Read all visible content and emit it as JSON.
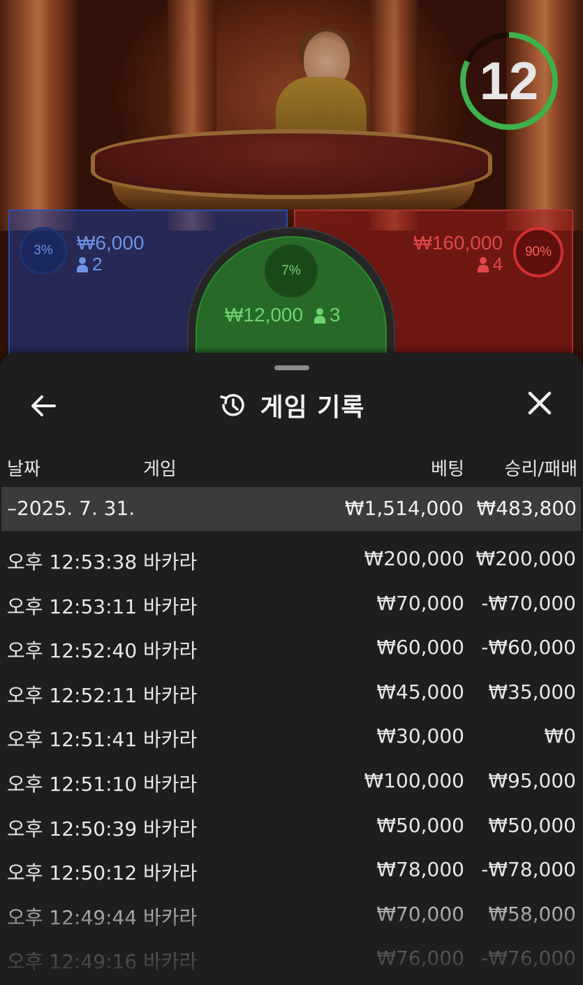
{
  "video": {
    "countdown": "12",
    "countdown_progress": 0.82,
    "player": {
      "pct": "3%",
      "amount": "₩6,000",
      "count": "2",
      "color": "#2a4fb0"
    },
    "tie": {
      "pct": "7%",
      "amount": "₩12,000",
      "count": "3",
      "color": "#2f8a2f"
    },
    "banker": {
      "pct": "90%",
      "amount": "₩160,000",
      "count": "4",
      "color": "#b03030"
    }
  },
  "sheet": {
    "title": "게임 기록",
    "columns": {
      "date": "날짜",
      "game": "게임",
      "bet": "베팅",
      "win_loss": "승리/패배"
    },
    "day": {
      "date": "–2025. 7. 31.",
      "bet": "₩1,514,000",
      "win_loss": "₩483,800"
    },
    "rows": [
      {
        "time": "오후 12:53:38",
        "game": "바카라",
        "bet": "₩200,000",
        "win_loss": "₩200,000"
      },
      {
        "time": "오후 12:53:11",
        "game": "바카라",
        "bet": "₩70,000",
        "win_loss": "-₩70,000"
      },
      {
        "time": "오후 12:52:40",
        "game": "바카라",
        "bet": "₩60,000",
        "win_loss": "-₩60,000"
      },
      {
        "time": "오후 12:52:11",
        "game": "바카라",
        "bet": "₩45,000",
        "win_loss": "₩35,000"
      },
      {
        "time": "오후 12:51:41",
        "game": "바카라",
        "bet": "₩30,000",
        "win_loss": "₩0"
      },
      {
        "time": "오후 12:51:10",
        "game": "바카라",
        "bet": "₩100,000",
        "win_loss": "₩95,000"
      },
      {
        "time": "오후 12:50:39",
        "game": "바카라",
        "bet": "₩50,000",
        "win_loss": "₩50,000"
      },
      {
        "time": "오후 12:50:12",
        "game": "바카라",
        "bet": "₩78,000",
        "win_loss": "-₩78,000"
      },
      {
        "time": "오후 12:49:44",
        "game": "바카라",
        "bet": "₩70,000",
        "win_loss": "₩58,000"
      },
      {
        "time": "오후 12:49:16",
        "game": "바카라",
        "bet": "₩76,000",
        "win_loss": "-₩76,000"
      }
    ]
  }
}
